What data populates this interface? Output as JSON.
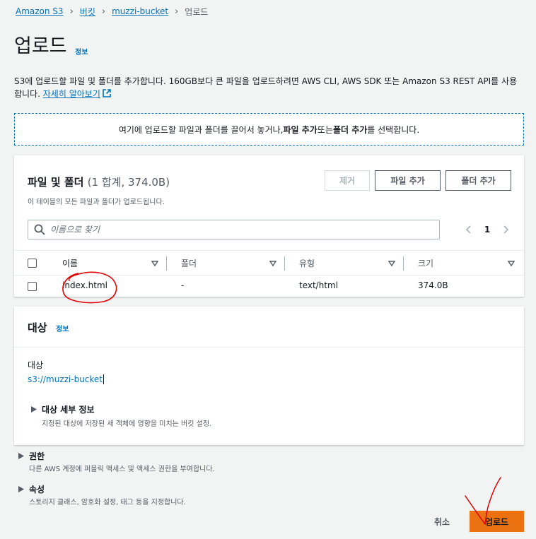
{
  "breadcrumb": {
    "items": [
      "Amazon S3",
      "버킷",
      "muzzi-bucket"
    ],
    "current": "업로드"
  },
  "header": {
    "title": "업로드",
    "info": "정보"
  },
  "description": {
    "text": "S3에 업로드할 파일 및 폴더를 추가합니다. 160GB보다 큰 파일을 업로드하려면 AWS CLI, AWS SDK 또는 Amazon S3 REST API를 사용합니다.",
    "learn_more": "자세히 알아보기"
  },
  "dropzone": {
    "prefix": "여기에 업로드할 파일과 폴더를 끌어서 놓거나, ",
    "add_files": "파일 추가",
    "middle": " 또는 ",
    "add_folder": "폴더 추가",
    "suffix": "를 선택합니다."
  },
  "files_panel": {
    "title": "파일 및 폴더",
    "count": "(1 합계, 374.0B)",
    "subtitle": "이 테이블의 모든 파일과 폴더가 업로드됩니다.",
    "buttons": {
      "remove": "제거",
      "add_files": "파일 추가",
      "add_folder": "폴더 추가"
    },
    "search_placeholder": "이름으로 찾기",
    "page": "1",
    "columns": [
      "이름",
      "폴더",
      "유형",
      "크기"
    ],
    "rows": [
      {
        "name": "index.html",
        "folder": "-",
        "type": "text/html",
        "size": "374.0B"
      }
    ]
  },
  "destination": {
    "title": "대상",
    "info": "정보",
    "label": "대상",
    "value": "s3://muzzi-bucket",
    "details_title": "대상 세부 정보",
    "details_desc": "지정된 대상에 저장된 새 객체에 영향을 미치는 버킷 설정."
  },
  "permissions": {
    "title": "권한",
    "desc": "다른 AWS 계정에 퍼블릭 액세스 및 액세스 권한을 부여합니다."
  },
  "properties": {
    "title": "속성",
    "desc": "스토리지 클래스, 암호화 설정, 태그 등을 지정합니다."
  },
  "footer": {
    "cancel": "취소",
    "upload": "업로드"
  },
  "colors": {
    "link": "#0073bb",
    "primary": "#ec7211",
    "annotation": "#e00000",
    "background": "#f2f3f3"
  },
  "icons": [
    "search-icon",
    "external-link-icon",
    "chevron-left-icon",
    "chevron-right-icon",
    "sort-icon",
    "caret-right-icon"
  ]
}
